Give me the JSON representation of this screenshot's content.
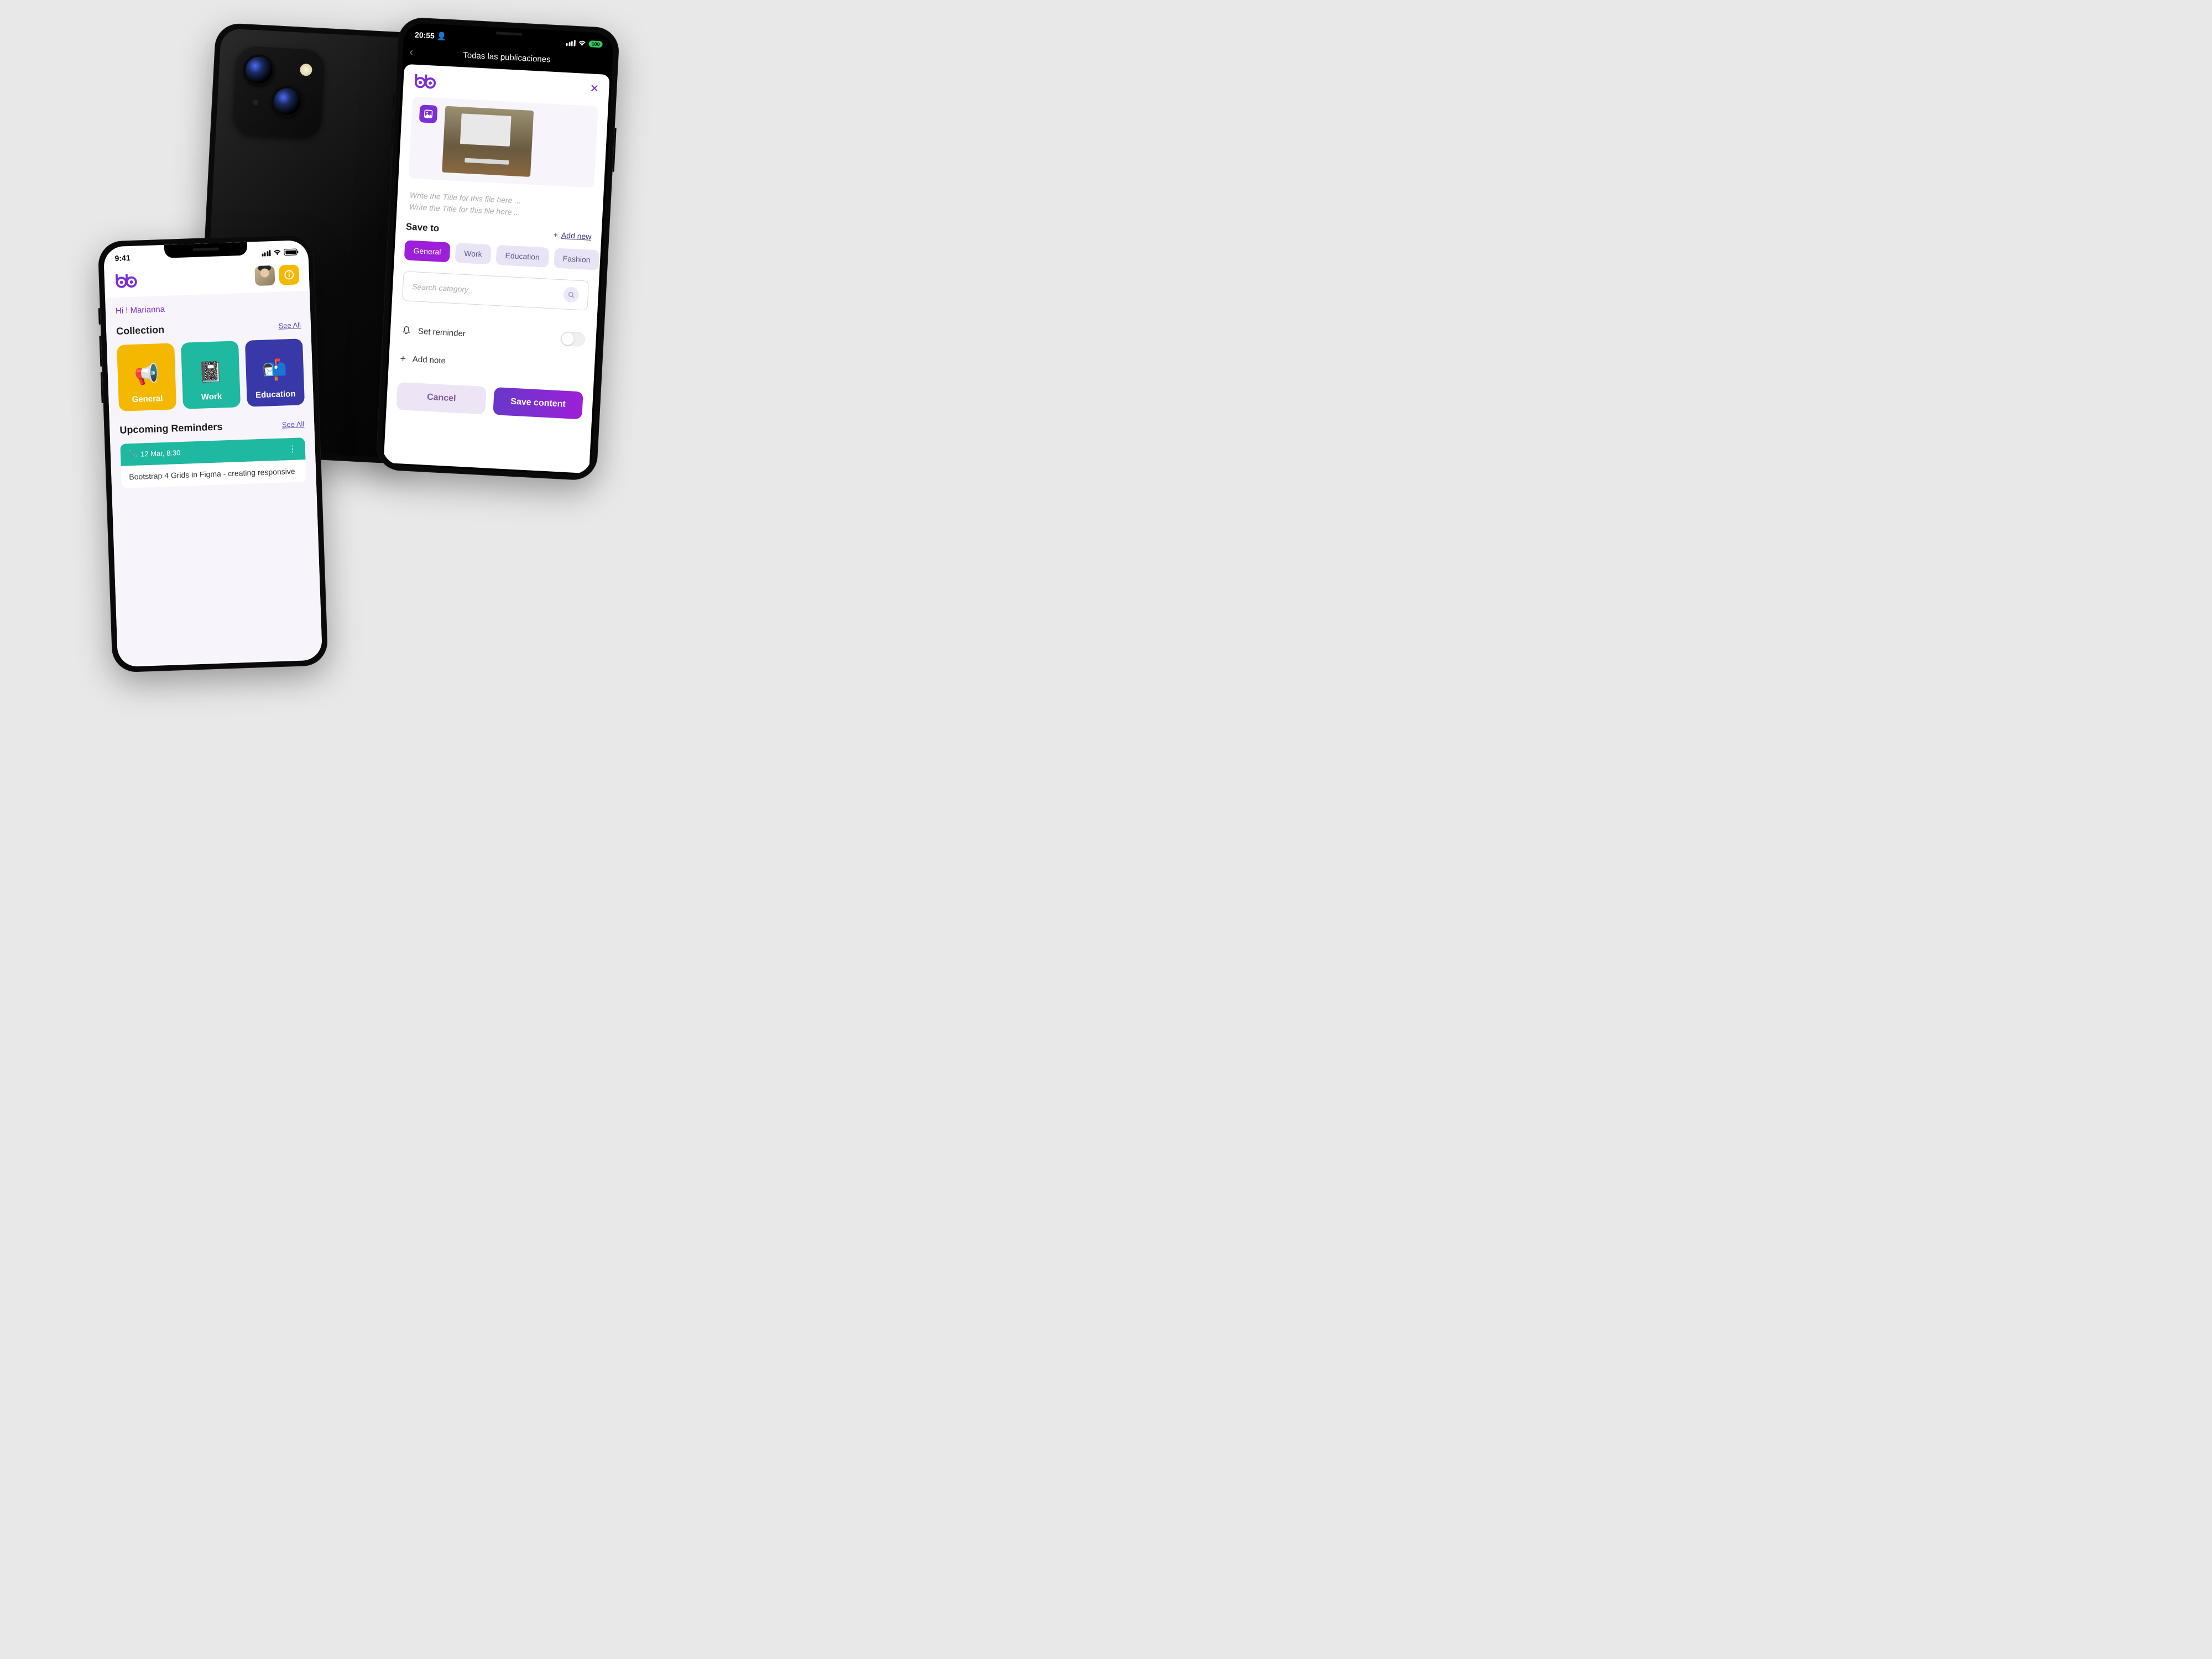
{
  "left_phone": {
    "status": {
      "time": "9:41"
    },
    "greeting": "Hi ! Marianna",
    "collection": {
      "title": "Collection",
      "see_all": "See All",
      "items": [
        {
          "label": "General"
        },
        {
          "label": "Work"
        },
        {
          "label": "Education"
        }
      ]
    },
    "reminders": {
      "title": "Upcoming Reminders",
      "see_all": "See All",
      "items": [
        {
          "time": "12 Mar, 8:30",
          "text": "Bootstrap 4 Grids in Figma - creating responsive"
        }
      ]
    }
  },
  "right_phone": {
    "status": {
      "time": "20:55",
      "battery": "100"
    },
    "header_title": "Todas las publicaciones",
    "title_placeholder_1": "Write the Title for this file here ...",
    "title_placeholder_2": "Write the Title for this file here ...",
    "save_to": {
      "label": "Save to",
      "add_new": "Add new",
      "categories": [
        {
          "label": "General",
          "active": true
        },
        {
          "label": "Work",
          "active": false
        },
        {
          "label": "Education",
          "active": false
        },
        {
          "label": "Fashion",
          "active": false
        }
      ],
      "search_placeholder": "Search category"
    },
    "reminder_label": "Set reminder",
    "add_note_label": "Add note",
    "buttons": {
      "cancel": "Cancel",
      "save": "Save content"
    }
  }
}
